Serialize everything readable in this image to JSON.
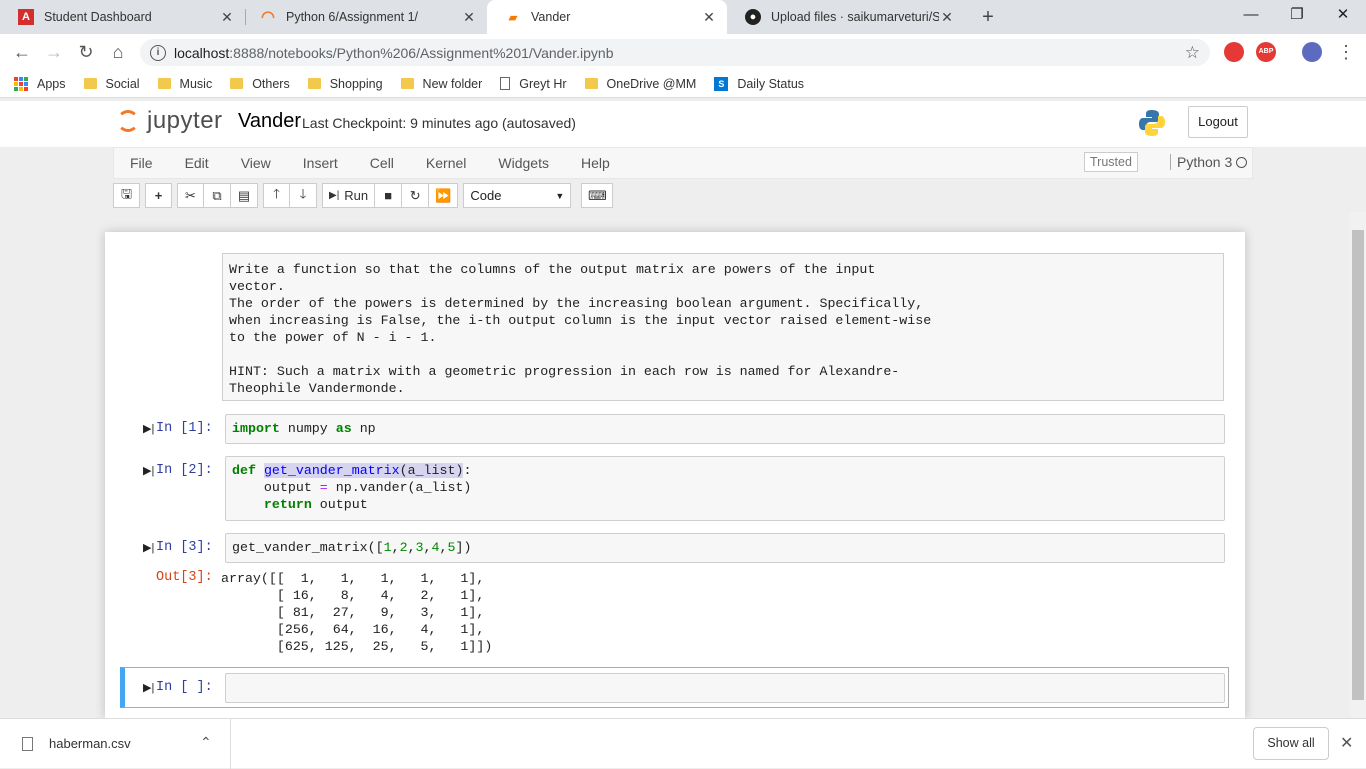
{
  "browser": {
    "tabs": [
      {
        "title": "Student Dashboard",
        "icon": "a-icon"
      },
      {
        "title": "Python 6/Assignment 1/",
        "icon": "jupyter-icon"
      },
      {
        "title": "Vander",
        "icon": "notebook-icon"
      },
      {
        "title": "Upload files · saikumarveturi/Ses",
        "icon": "github-icon"
      }
    ],
    "url_host": "localhost",
    "url_path": ":8888/notebooks/Python%206/Assignment%201/Vander.ipynb",
    "bookmarks": [
      "Apps",
      "Social",
      "Music",
      "Others",
      "Shopping",
      "New folder",
      "Greyt Hr",
      "OneDrive @MM",
      "Daily Status"
    ]
  },
  "jupyter": {
    "logo_text": "jupyter",
    "notebook_name": "Vander",
    "checkpoint": "Last Checkpoint: 9 minutes ago  (autosaved)",
    "logout_label": "Logout",
    "menu": [
      "File",
      "Edit",
      "View",
      "Insert",
      "Cell",
      "Kernel",
      "Widgets",
      "Help"
    ],
    "trusted": "Trusted",
    "kernel": "Python 3",
    "run_label": "Run",
    "cell_type": "Code"
  },
  "cells": {
    "markdown": "Write a function so that the columns of the output matrix are powers of the input\nvector.\nThe order of the powers is determined by the increasing boolean argument. Specifically,\nwhen increasing is False, the i-th output column is the input vector raised element-wise\nto the power of N - i - 1.\n\nHINT: Such a matrix with a geometric progression in each row is named for Alexandre-\nTheophile Vandermonde.",
    "prompt1": "In [1]:",
    "prompt2": "In [2]:",
    "prompt3": "In [3]:",
    "out3": "Out[3]:",
    "output3": "array([[  1,   1,   1,   1,   1],\n       [ 16,   8,   4,   2,   1],\n       [ 81,  27,   9,   3,   1],\n       [256,  64,  16,   4,   1],\n       [625, 125,  25,   5,   1]])",
    "prompt4": "In [ ]:"
  },
  "downloads": {
    "file": "haberman.csv",
    "show_all": "Show all"
  }
}
